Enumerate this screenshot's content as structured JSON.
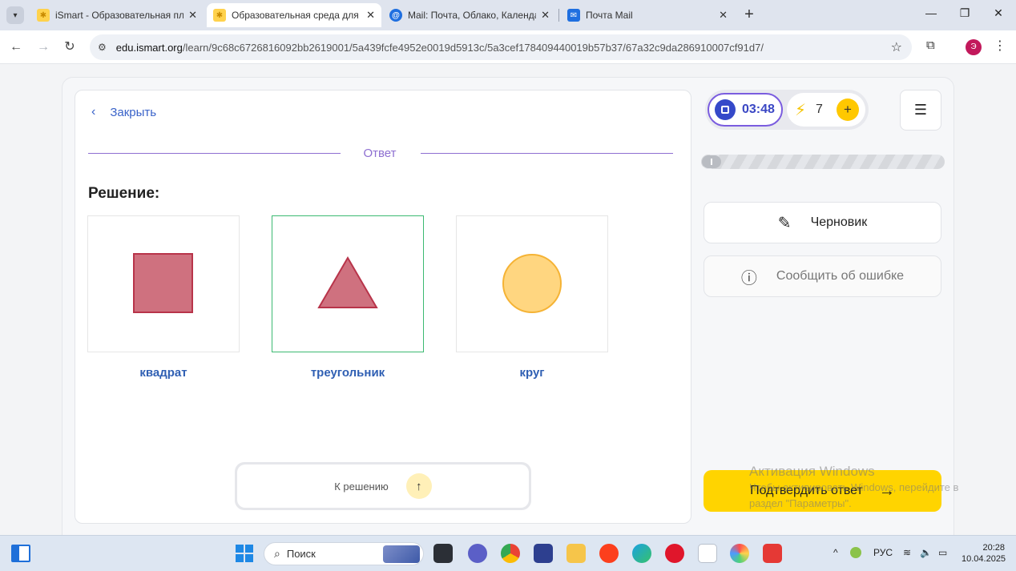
{
  "browser": {
    "tabs": [
      {
        "title": "iSmart - Образовательная пла",
        "icon": "ismart-favicon"
      },
      {
        "title": "Образовательная среда для с",
        "icon": "ismart-favicon",
        "active": true
      },
      {
        "title": "Mail: Почта, Облако, Календар",
        "icon": "mail-favicon"
      },
      {
        "title": "Почта Mail",
        "icon": "mail-favicon"
      }
    ],
    "url_host": "edu.ismart.org",
    "url_path": "/learn/9c68c6726816092bb2619001/5a439fcfe4952e0019d5913c/5a3cef178409440019b57b37/67a32c9da286910007cf91d7/",
    "profile_initial": "Э"
  },
  "lesson": {
    "close_label": "Закрыть",
    "divider_label": "Ответ",
    "solution_title": "Решение:",
    "options": [
      {
        "label": "квадрат",
        "shape": "square",
        "color": "#cf717f",
        "stroke": "#b8344a"
      },
      {
        "label": "треугольник",
        "shape": "triangle",
        "color": "#cf717f",
        "stroke": "#b8344a",
        "selected": true
      },
      {
        "label": "круг",
        "shape": "circle",
        "color": "#ffd680",
        "stroke": "#f5b335"
      }
    ],
    "to_solution_label": "К решению"
  },
  "side": {
    "timer": "03:48",
    "energy": "7",
    "progress": 0,
    "draft_label": "Черновик",
    "report_label": "Сообщить об ошибке",
    "submit_label": "Подтвердить ответ"
  },
  "watermark": {
    "line1": "Активация Windows",
    "line2": "Чтобы активировать Windows, перейдите в",
    "line3": "раздел \"Параметры\"."
  },
  "taskbar": {
    "search_label": "Поиск",
    "lang": "РУС",
    "time": "20:28",
    "date": "10.04.2025"
  }
}
